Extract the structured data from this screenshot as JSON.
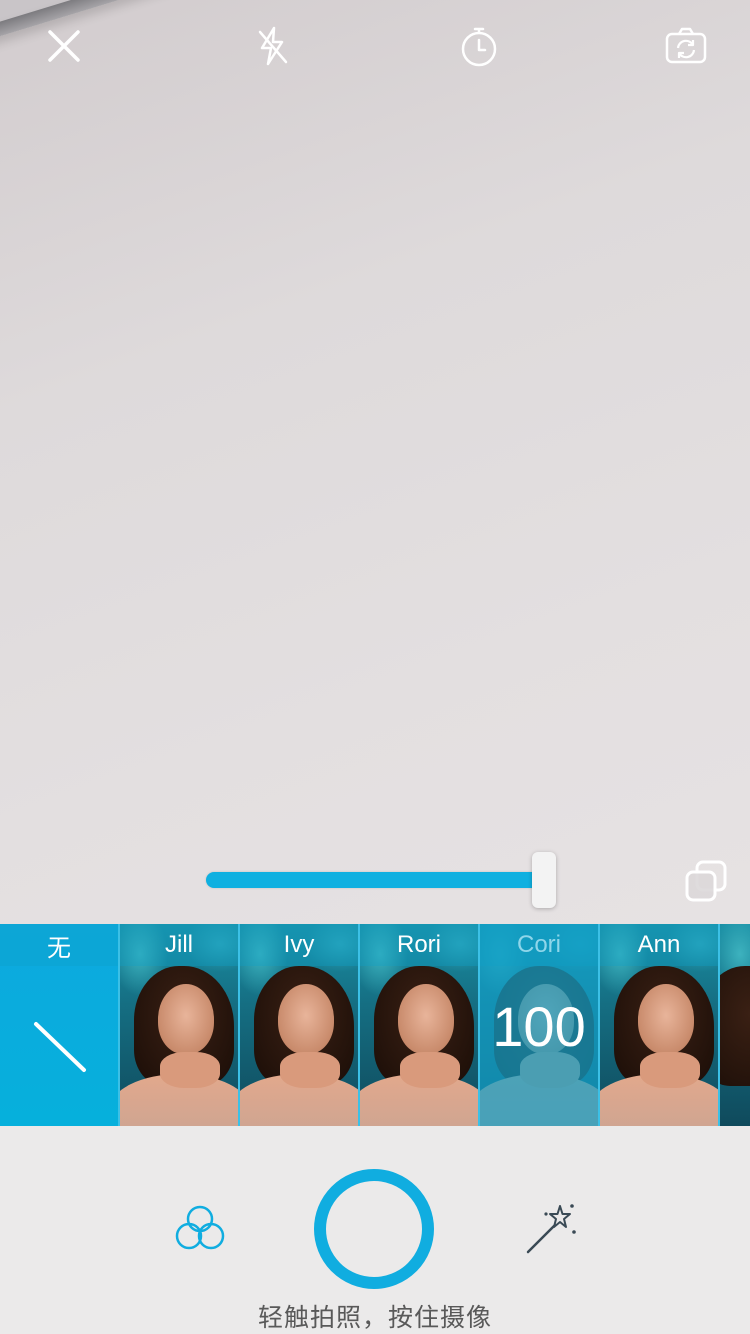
{
  "top_bar": {
    "close_icon": "close-icon",
    "flash_icon": "flash-off-icon",
    "timer_icon": "timer-icon",
    "switch_camera_icon": "switch-camera-icon"
  },
  "zoom": {
    "level": 1.0
  },
  "filters": [
    {
      "label": "无"
    },
    {
      "label": "Jill"
    },
    {
      "label": "Ivy"
    },
    {
      "label": "Rori"
    },
    {
      "label": "Cori",
      "selected": true,
      "intensity": "100"
    },
    {
      "label": "Ann"
    }
  ],
  "bottom": {
    "hint": "轻触拍照，按住摄像"
  },
  "colors": {
    "accent": "#10ade0",
    "bottom_bg": "#ebeaea"
  }
}
